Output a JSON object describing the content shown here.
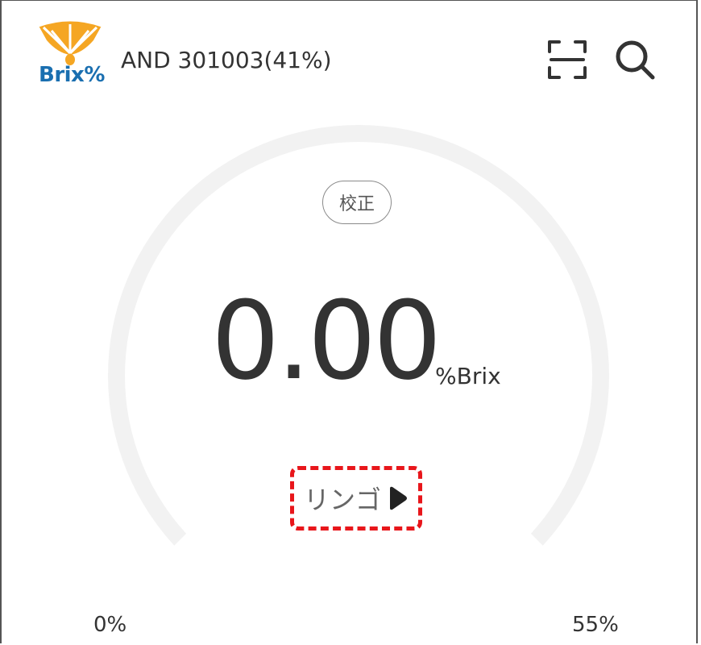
{
  "header": {
    "logo_text": "Brix%",
    "device_name": "AND 301003(41%)",
    "scan_icon": "scan-icon",
    "search_icon": "search-icon"
  },
  "gauge": {
    "calibrate_label": "校正",
    "reading": "0.00",
    "unit": "%Brix",
    "fruit": "リンゴ",
    "fruit_arrow_icon": "play-arrow-icon",
    "min_label": "0%",
    "max_label": "55%",
    "progress_fraction": 0.0
  },
  "colors": {
    "brand_blue": "#1a6fb0",
    "logo_orange": "#f5a623",
    "gauge_track": "#f2f2f2",
    "highlight_red": "#e8161b",
    "text_dark": "#333333"
  }
}
